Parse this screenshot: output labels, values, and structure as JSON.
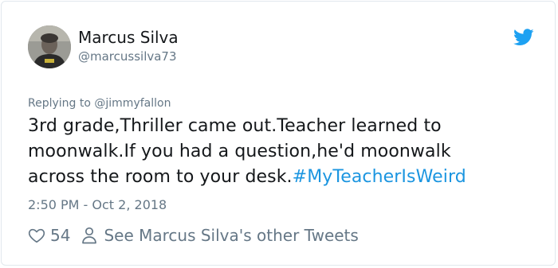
{
  "tweet": {
    "author_name": "Marcus Silva",
    "author_handle": "@marcussilva73",
    "reply_prefix": "Replying to ",
    "reply_to": "@jimmyfallon",
    "text_lines": [
      "3rd grade,Thriller came out.Teacher learned to",
      "moonwalk.If you had a question,he'd moonwalk",
      "across the room to your desk."
    ],
    "hashtag": "#MyTeacherIsWeird",
    "timestamp": "2:50 PM - Oct 2, 2018",
    "like_count": "54",
    "other_tweets_label": "See Marcus Silva's other Tweets"
  },
  "icons": {
    "brand": "twitter-bird-icon",
    "like": "heart-icon",
    "profile": "person-icon"
  },
  "colors": {
    "link": "#1b95e0",
    "muted": "#657786",
    "text": "#14171a",
    "border": "#e1e8ed"
  }
}
